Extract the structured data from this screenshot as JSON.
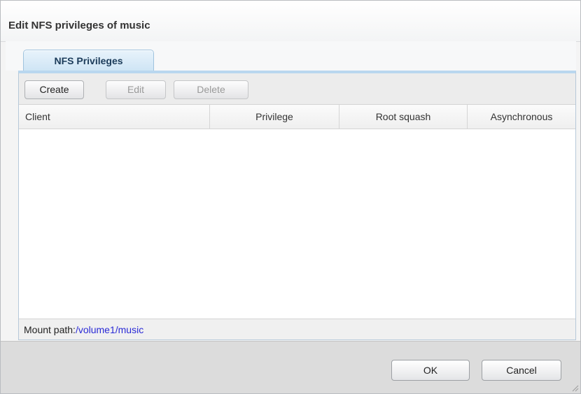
{
  "window": {
    "title": "Edit NFS privileges of music"
  },
  "tabs": [
    {
      "label": "NFS Privileges",
      "active": true
    }
  ],
  "toolbar": {
    "create_label": "Create",
    "edit_label": "Edit",
    "delete_label": "Delete"
  },
  "table": {
    "columns": [
      "Client",
      "Privilege",
      "Root squash",
      "Asynchronous"
    ],
    "rows": []
  },
  "footer": {
    "mount_label": "Mount path:",
    "mount_value": "/volume1/music"
  },
  "actions": {
    "ok_label": "OK",
    "cancel_label": "Cancel"
  },
  "colors": {
    "tab_accent": "#cfe5f5",
    "link_blue": "#2a2ad6"
  }
}
